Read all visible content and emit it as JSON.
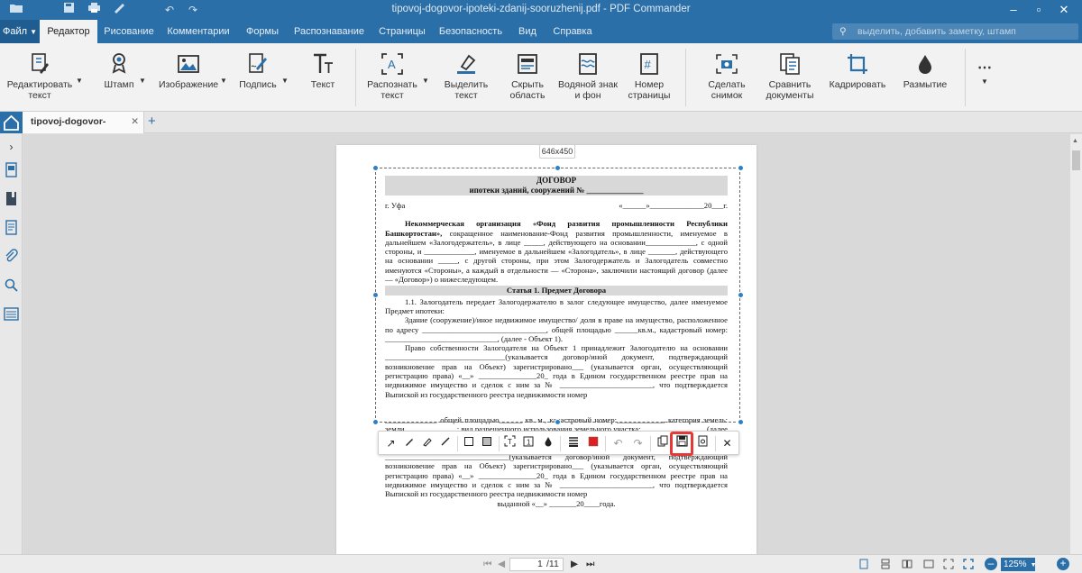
{
  "titlebar": {
    "title": "tipovoj-dogovor-ipoteki-zdanij-sooruzhenij.pdf - PDF Commander"
  },
  "menu": {
    "file": "Файл",
    "editor": "Редактор",
    "drawing": "Рисование",
    "comments": "Комментарии",
    "forms": "Формы",
    "recognition": "Распознавание",
    "pages": "Страницы",
    "security": "Безопасность",
    "view": "Вид",
    "help": "Справка",
    "search_placeholder": "выделить, добавить заметку, штамп"
  },
  "ribbon": {
    "edit_text": [
      "Редактировать",
      "текст"
    ],
    "stamp": "Штамп",
    "image": "Изображение",
    "signature": "Подпись",
    "text": "Текст",
    "recognize_text": [
      "Распознать",
      "текст"
    ],
    "highlight_text": [
      "Выделить",
      "текст"
    ],
    "hide_area": [
      "Скрыть",
      "область"
    ],
    "watermark": [
      "Водяной знак",
      "и фон"
    ],
    "page_number": [
      "Номер",
      "страницы"
    ],
    "snapshot": [
      "Сделать",
      "снимок"
    ],
    "compare": [
      "Сравнить",
      "документы"
    ],
    "crop": "Кадрировать",
    "blur": "Размытие"
  },
  "tab": {
    "name": "tipovoj-dogovor-ipoteki-..."
  },
  "selection": {
    "size": "646x450"
  },
  "document": {
    "title": "ДОГОВОР",
    "subtitle": "ипотеки зданий, сооружений № ______________",
    "city": "г. Уфа",
    "date": "«______»______________20___г.",
    "p1_bold": "Некоммерческая организация «Фонд развития промышленности Республики Башкортостан»,",
    "p1_rest": " сокращенное наименование-Фонд развития промышленности, именуемое в дальнейшем «Залогодержатель», в лице _____, действующего на основании_____________, с одной стороны, и _____________, именуемое в дальнейшем «Залогодатель», в лице _______, действующего на основании _____, с другой стороны, при этом Залогодержатель и Залогодатель совместно именуются «Стороны», а каждый в отдельности — «Сторона», заключили настоящий договор (далее — «Договор») о нижеследующем.",
    "article1": "Статья 1. Предмет Договора",
    "p11": "1.1. Залогодатель передает Залогодержателю в залог следующее имущество, далее именуемое Предмет ипотеки:",
    "p_building": "Здание (сооружение)/иное недвижимое имущество/ доля в праве на имущество, расположенное по адресу ________________________________, общей площадью ______кв.м., кадастровый номер: _____________________________, (далее - Объект 1).",
    "p_right1": "Право собственности Залогодателя на Объект 1 принадлежит Залогодателю на основании _______________________________(указывается договор/иной документ, подтверждающий возникновение прав на Объект) зарегистрировано___ (указывается орган, осуществляющий регистрацию права) «__» _______________20_ года в Едином государственном реестре прав на недвижимое имущество и сделок с ним за № ________________________, что подтверждается Выпиской из государственного реестра недвижимости номер",
    "p_land": "_____________, общей площадью______ кв. м., кадастровый номер:____________, категория земель: земли _____________; вид разрешенного использования земельного участка: ________________ (далее – Объект 2).",
    "p_right2": "Право собственности Залогодателя на Объект 2 принадлежит Залогодателю на основании ________________________________(указывается договор/иной документ, подтверждающий возникновение прав на Объект) зарегистрировано___ (указывается орган, осуществляющий регистрацию права) «__» _______________20_ года в Едином государственном реестре прав на недвижимое имущество и сделок с ним за № ________________________, что подтверждается Выпиской из государственного реестра недвижимости номер",
    "p_tail": "выданной «__» _______20____года."
  },
  "status": {
    "page_current": "1",
    "page_total": "/11",
    "zoom": "125%"
  },
  "colors": {
    "accent": "#2b6fa8",
    "highlight": "#e53935"
  }
}
